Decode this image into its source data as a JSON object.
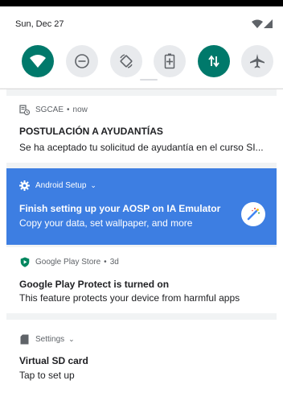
{
  "status_bar": {
    "date": "Sun, Dec 27",
    "wifi_icon": "wifi-icon",
    "signal_icon": "signal-icon"
  },
  "quick_settings": {
    "tiles": [
      {
        "name": "wifi",
        "icon": "wifi-icon",
        "active": true
      },
      {
        "name": "do-not-disturb",
        "icon": "do-not-disturb-icon",
        "active": false
      },
      {
        "name": "auto-rotate",
        "icon": "auto-rotate-icon",
        "active": false
      },
      {
        "name": "battery-saver",
        "icon": "battery-icon",
        "active": false
      },
      {
        "name": "mobile-data",
        "icon": "data-arrows-icon",
        "active": true
      },
      {
        "name": "airplane-mode",
        "icon": "airplane-icon",
        "active": false
      }
    ],
    "accent_color": "#00796b"
  },
  "notifications": [
    {
      "app": "SGCAE",
      "time": "now",
      "title": "POSTULACIÓN A AYUDANTÍAS",
      "body": "Se ha aceptado tu solicitud de ayudantía en el curso SI..."
    },
    {
      "app": "Android Setup",
      "title": "Finish setting up your AOSP on IA Emulator",
      "body": "Copy your data, set wallpaper, and more",
      "background": "#3d7ee2"
    },
    {
      "app": "Google Play Store",
      "time": "3d",
      "title": "Google Play Protect is turned on",
      "body": "This feature protects your device from harmful apps"
    },
    {
      "app": "Settings",
      "title": "Virtual SD card",
      "body": "Tap to set up"
    }
  ],
  "separator": "•"
}
